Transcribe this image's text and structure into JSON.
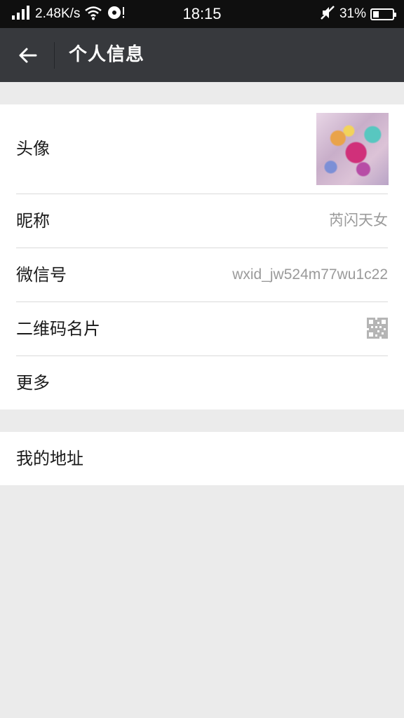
{
  "status_bar": {
    "net_speed": "2.48K/s",
    "time": "18:15",
    "battery": "31%",
    "battery_level": 0.31,
    "icons": [
      "signal-icon",
      "wifi-icon",
      "disc-icon",
      "mute-icon",
      "battery-icon"
    ]
  },
  "header": {
    "title": "个人信息",
    "back_icon": "back-arrow-icon"
  },
  "profile": {
    "rows": [
      {
        "label": "头像",
        "value": ""
      },
      {
        "label": "昵称",
        "value": "芮闪天女"
      },
      {
        "label": "微信号",
        "value": "wxid_jw524m77wu1c22"
      },
      {
        "label": "二维码名片",
        "value": ""
      },
      {
        "label": "更多",
        "value": ""
      }
    ]
  },
  "address": {
    "label": "我的地址"
  }
}
